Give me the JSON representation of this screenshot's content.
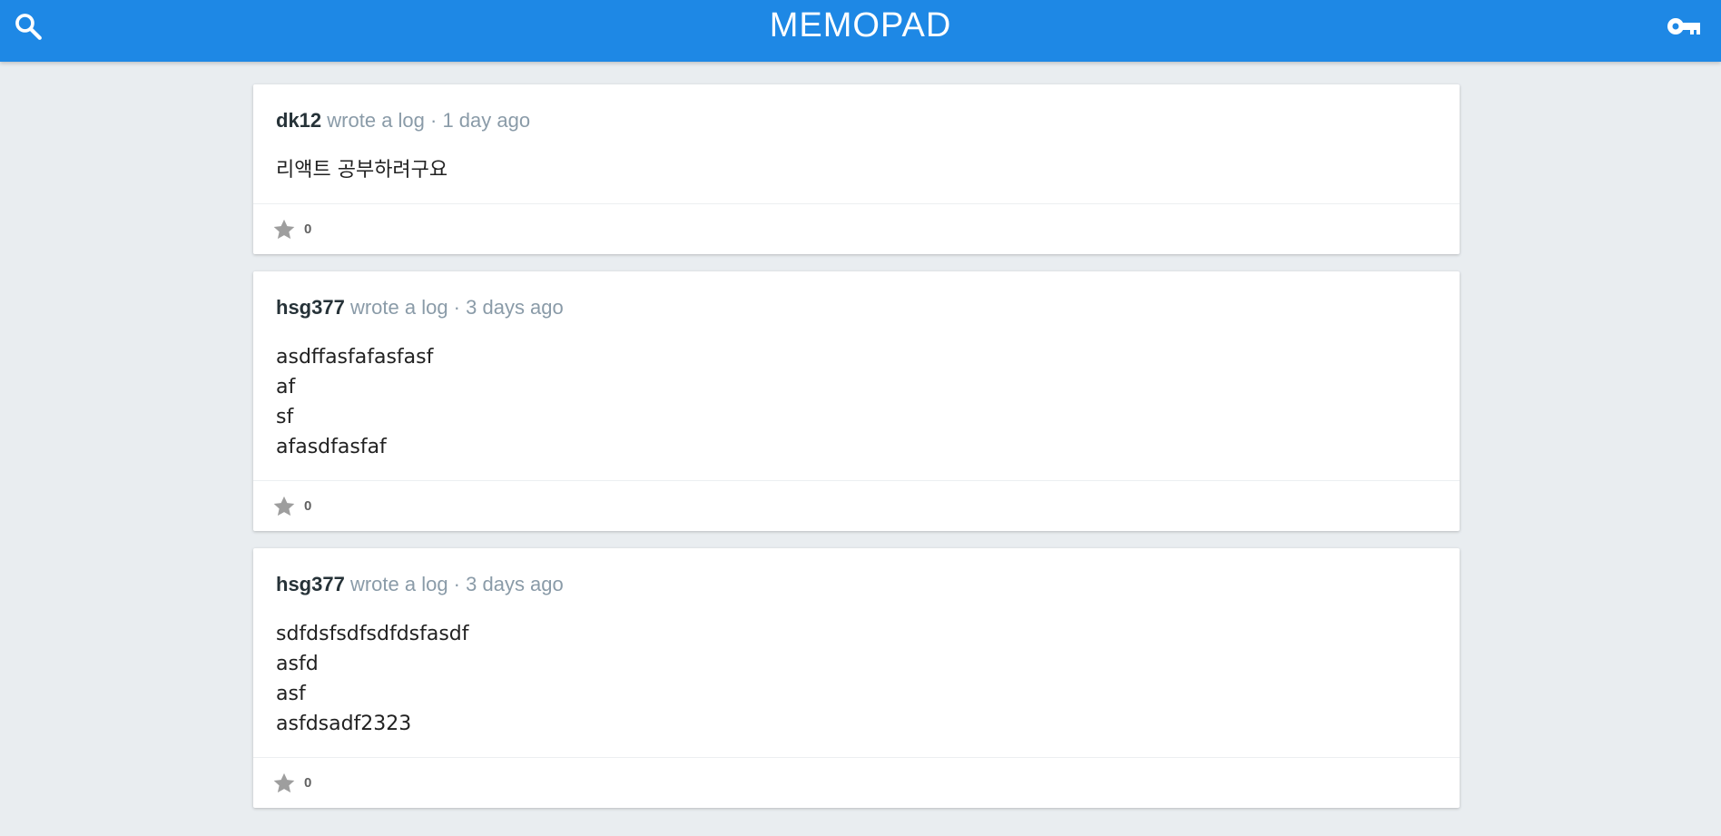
{
  "header": {
    "title": "MEMOPAD",
    "search_icon": "search-icon",
    "key_icon": "key-icon"
  },
  "memos": [
    {
      "author": "dk12",
      "meta": "wrote a log · 1 day ago",
      "content": "리액트 공부하려구요",
      "stars": "0"
    },
    {
      "author": "hsg377",
      "meta": "wrote a log · 3 days ago",
      "content": "asdffasfafasfasf\naf\nsf\nafasdfasfaf",
      "stars": "0"
    },
    {
      "author": "hsg377",
      "meta": "wrote a log · 3 days ago",
      "content": "sdfdsfsdfsdfdsfasdf\nasfd\nasf\nasfdsadf2323",
      "stars": "0"
    }
  ],
  "colors": {
    "brand": "#1e88e5",
    "background": "#e9edf0",
    "meta_text": "#8a9ba8",
    "star": "#9e9e9e"
  }
}
